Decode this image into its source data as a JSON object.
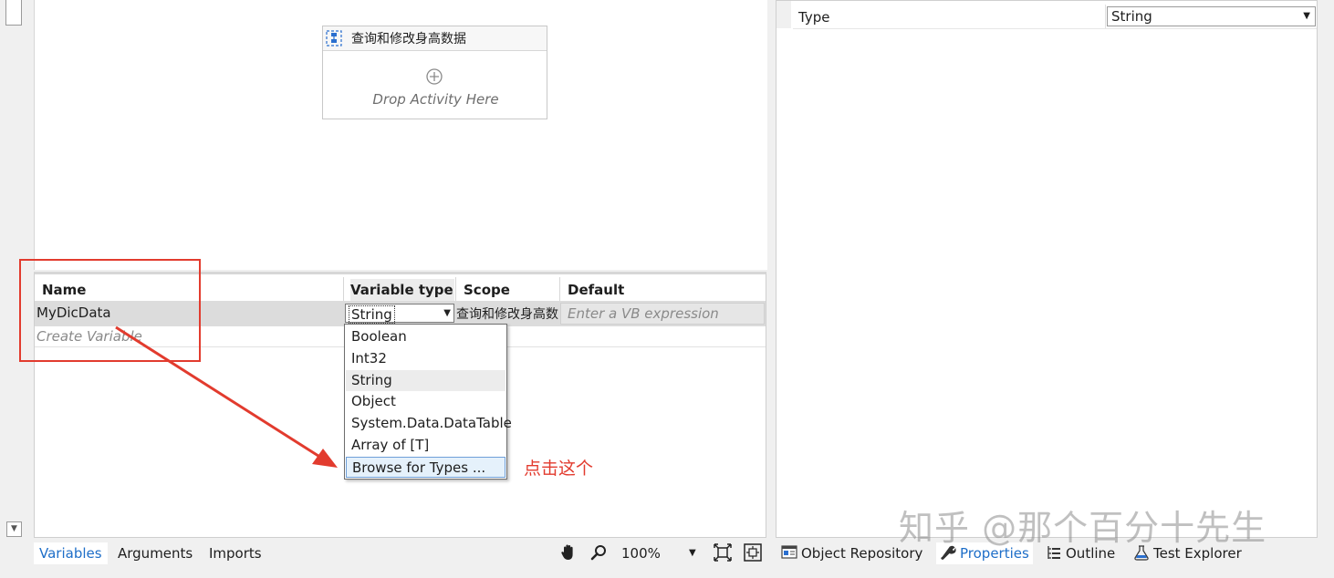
{
  "designer": {
    "sequence_title": "查询和修改身高数据",
    "drop_text": "Drop Activity Here"
  },
  "variables": {
    "columns": {
      "name": "Name",
      "variable_type": "Variable type",
      "scope": "Scope",
      "default": "Default"
    },
    "row": {
      "name": "MyDicData",
      "type": "String",
      "scope": "查询和修改身高数据",
      "default_placeholder": "Enter a VB expression"
    },
    "create_placeholder": "Create Variable"
  },
  "type_dropdown": {
    "items": [
      "Boolean",
      "Int32",
      "String",
      "Object",
      "System.Data.DataTable",
      "Array of [T]",
      "Browse for Types ..."
    ],
    "selected": "String",
    "hovered": "Browse for Types ..."
  },
  "annotation": {
    "text": "点击这个",
    "color": "#e23b2e"
  },
  "bottom_bar": {
    "tabs": [
      "Variables",
      "Arguments",
      "Imports"
    ],
    "active_tab": "Variables",
    "zoom": "100%",
    "icons": [
      "hand-icon",
      "search-icon",
      "fit-to-screen-icon",
      "overview-icon"
    ]
  },
  "properties": {
    "type_label": "Type",
    "type_value": "String"
  },
  "right_tabs": {
    "object_repository": "Object Repository",
    "properties": "Properties",
    "outline": "Outline",
    "test_explorer": "Test Explorer",
    "active_tab": "Properties"
  },
  "watermark": "知乎 @那个百分十先生",
  "colors": {
    "accent_blue": "#1e6ec8",
    "annotation_red": "#e23b2e"
  }
}
